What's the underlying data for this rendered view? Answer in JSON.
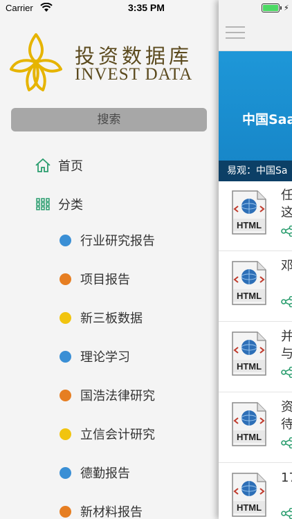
{
  "status_bar": {
    "carrier": "Carrier",
    "time": "3:35 PM"
  },
  "brand": {
    "name_cn": "投资数据库",
    "name_en": "INVEST DATA",
    "color": "#5b4a1e",
    "logo_color": "#e6b400"
  },
  "sidebar": {
    "search_label": "搜索",
    "home_label": "首页",
    "category_label": "分类",
    "categories": [
      {
        "label": "行业研究报告",
        "color": "#3a8fd5"
      },
      {
        "label": "项目报告",
        "color": "#e67e22"
      },
      {
        "label": "新三板数据",
        "color": "#f1c40f"
      },
      {
        "label": "理论学习",
        "color": "#3a8fd5"
      },
      {
        "label": "国浩法律研究",
        "color": "#e67e22"
      },
      {
        "label": "立信会计研究",
        "color": "#f1c40f"
      },
      {
        "label": "德勤报告",
        "color": "#3a8fd5"
      },
      {
        "label": "新材料报告",
        "color": "#e67e22"
      }
    ]
  },
  "main": {
    "banner_title": "中国Saa",
    "banner_caption": "易观：中国Sa",
    "articles": [
      {
        "title": "任\n这",
        "icon": "html-doc-icon"
      },
      {
        "title": "邓",
        "icon": "html-doc-icon"
      },
      {
        "title": "并\n与",
        "icon": "html-doc-icon"
      },
      {
        "title": "资\n待",
        "icon": "html-doc-icon"
      },
      {
        "title": "17",
        "icon": "html-doc-icon"
      }
    ],
    "html_badge": "HTML"
  },
  "colors": {
    "accent_green": "#2a9d6e",
    "banner_blue": "#1e97d8"
  }
}
